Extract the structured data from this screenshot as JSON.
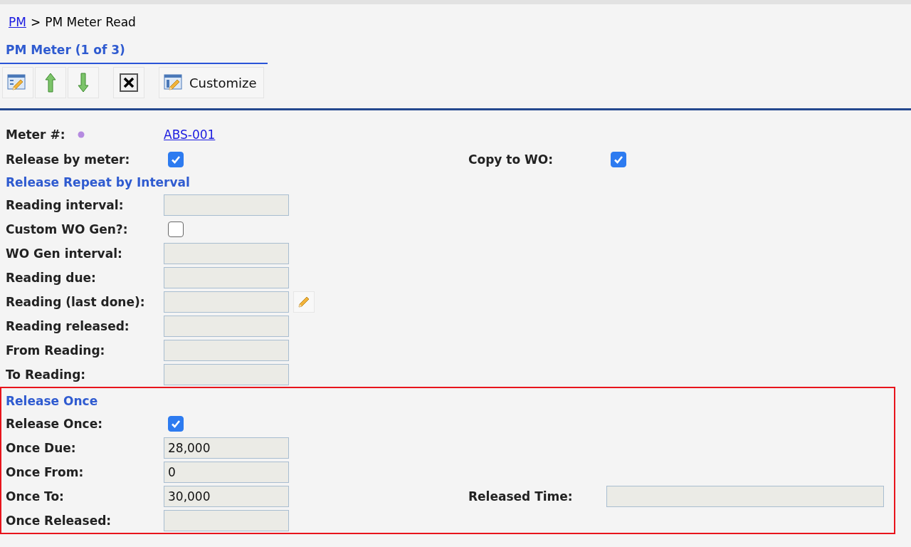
{
  "breadcrumb": {
    "link": "PM",
    "separator": ">",
    "current": "PM Meter Read"
  },
  "title": "PM Meter (1 of 3)",
  "toolbar": {
    "customize_label": "Customize"
  },
  "sections": [
    {
      "highlighted": false,
      "rows": [
        {
          "kind": "link",
          "label": "Meter #:",
          "value": "ABS-001"
        },
        {
          "kind": "checkbox",
          "label": "Release by meter:",
          "checked": true,
          "right": {
            "kind": "checkbox",
            "label": "Copy to WO:",
            "checked": true
          }
        }
      ]
    },
    {
      "heading": "Release Repeat by Interval",
      "highlighted": false,
      "rows": [
        {
          "kind": "field",
          "label": "Reading interval:"
        },
        {
          "kind": "checkbox",
          "label": "Custom WO Gen?:",
          "checked": false
        },
        {
          "kind": "field",
          "label": "WO Gen interval:"
        },
        {
          "kind": "field",
          "label": "Reading due:"
        },
        {
          "kind": "field_edit",
          "label": "Reading (last done):"
        },
        {
          "kind": "field",
          "label": "Reading released:"
        },
        {
          "kind": "field",
          "label": "From Reading:"
        },
        {
          "kind": "field",
          "label": "To Reading:"
        }
      ]
    },
    {
      "heading": "Release Once",
      "highlighted": true,
      "rows": [
        {
          "kind": "checkbox",
          "label": "Release Once:",
          "checked": true
        },
        {
          "kind": "field",
          "label": "Once Due:",
          "value": "28,000"
        },
        {
          "kind": "field",
          "label": "Once From:",
          "value": "0"
        },
        {
          "kind": "field",
          "label": "Once To:",
          "value": "30,000",
          "right": {
            "kind": "field",
            "label": "Released Time:"
          }
        },
        {
          "kind": "field",
          "label": "Once Released:"
        }
      ]
    }
  ]
}
